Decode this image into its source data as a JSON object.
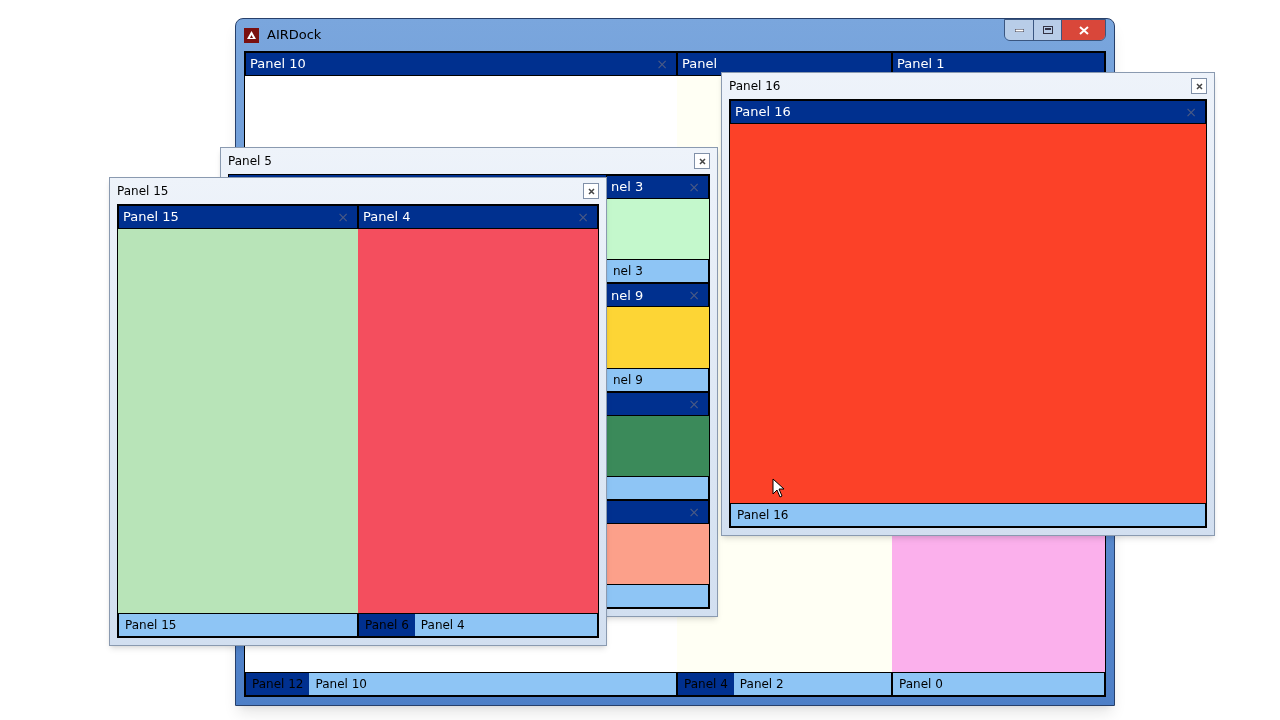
{
  "windows": [
    {
      "kind": "main",
      "title": "AIRDock",
      "panels": [
        {
          "header": "Panel 10",
          "close": "×",
          "color": "#ffffff",
          "tabs": [
            {
              "label": "Panel 12",
              "selected": false
            },
            {
              "label": "Panel 10",
              "selected": true
            }
          ]
        },
        {
          "header": "Panel",
          "color": "#fffff4",
          "tabs": [
            {
              "label": "Panel 4",
              "selected": false
            },
            {
              "label": "Panel 2",
              "selected": true
            }
          ]
        },
        {
          "header": "Panel 1",
          "color": "#fbb0ec",
          "tabs": [
            {
              "label": "Panel 0",
              "selected": true
            }
          ]
        }
      ]
    },
    {
      "kind": "stacked",
      "title": "Panel 5",
      "panels": [
        {
          "header": "nel 3",
          "close": "×",
          "color": "#c4f8cc",
          "tabs": [
            {
              "label": "nel 3",
              "selected": true
            }
          ]
        },
        {
          "header": "nel 9",
          "close": "×",
          "color": "#fdd535",
          "tabs": [
            {
              "label": "nel 9",
              "selected": true
            }
          ]
        },
        {
          "close": "×",
          "color": "#3b8a5a"
        },
        {
          "close": "×",
          "color": "#fca08a"
        }
      ]
    },
    {
      "kind": "floating",
      "title": "Panel 15",
      "panels": [
        {
          "header": "Panel 15",
          "close": "×",
          "color": "#b8e4b8",
          "tabs": [
            {
              "label": "Panel 15",
              "selected": true
            }
          ]
        },
        {
          "header": "Panel 4",
          "close": "×",
          "color": "#f44e5e",
          "tabs": [
            {
              "label": "Panel 6",
              "selected": false
            },
            {
              "label": "Panel 4",
              "selected": true
            }
          ]
        }
      ]
    },
    {
      "kind": "floating",
      "title": "Panel 16",
      "panels": [
        {
          "header": "Panel 16",
          "close": "×",
          "color": "#fc4128",
          "tabs": [
            {
              "label": "Panel 16",
              "selected": true
            }
          ]
        }
      ]
    }
  ]
}
